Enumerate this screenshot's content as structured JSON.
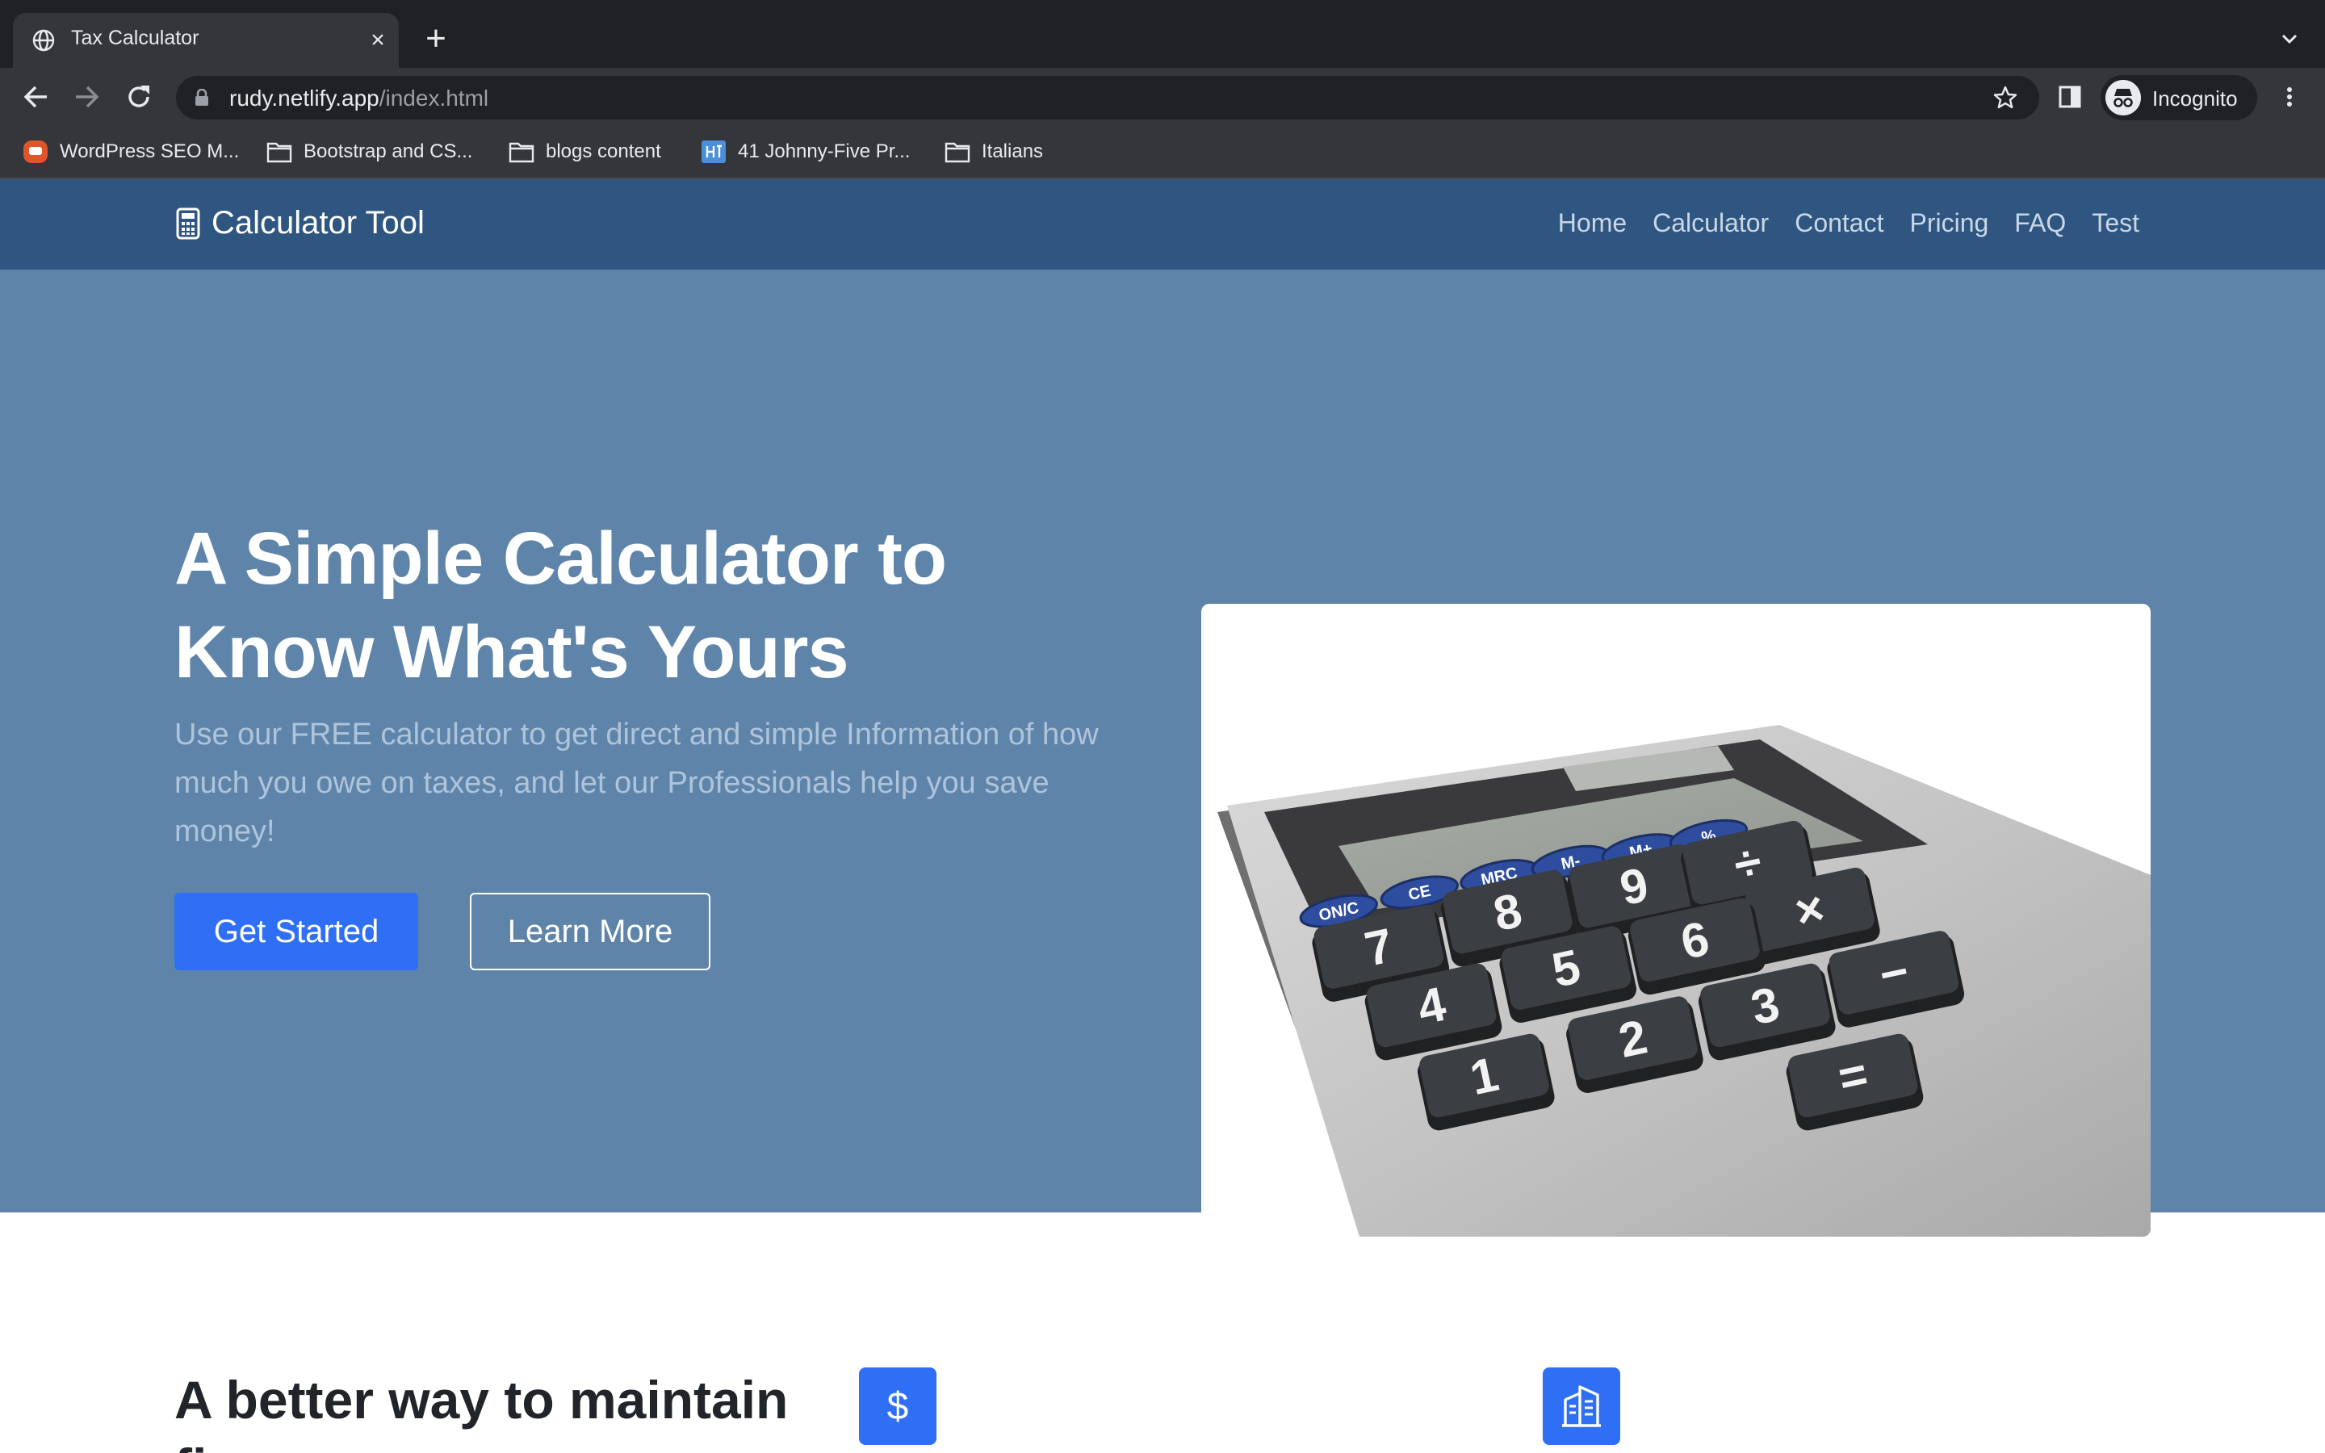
{
  "browser": {
    "tab_title": "Tax Calculator",
    "url_host": "rudy.netlify.app",
    "url_path": "/index.html",
    "profile_label": "Incognito",
    "bookmarks": [
      {
        "label": "WordPress SEO M...",
        "icon": "wordpress-seo-icon"
      },
      {
        "label": "Bootstrap and CS...",
        "icon": "folder-icon"
      },
      {
        "label": "blogs content",
        "icon": "folder-icon"
      },
      {
        "label": "41 Johnny-Five Pr...",
        "icon": "site-favicon-icon"
      },
      {
        "label": "Italians",
        "icon": "folder-icon"
      }
    ]
  },
  "navbar": {
    "brand": "Calculator Tool",
    "brand_icon": "calculator-icon",
    "links": [
      "Home",
      "Calculator",
      "Contact",
      "Pricing",
      "FAQ",
      "Test"
    ]
  },
  "hero": {
    "title": "A Simple Calculator to Know What's Yours",
    "subtitle": "Use our FREE calculator to get direct and simple Information of how much you owe on taxes, and let our Professionals help you save money!",
    "primary_button": "Get Started",
    "secondary_button": "Learn More",
    "image": "calculator-photo",
    "keys": [
      "ON/C",
      "CE",
      "MRC",
      "M-",
      "M+",
      "%",
      "7",
      "8",
      "9",
      "÷",
      "×",
      "4",
      "5",
      "6",
      "−",
      "1",
      "2",
      "3",
      "="
    ]
  },
  "features": {
    "title": "A better way to maintain finances",
    "icons": [
      "dollar-icon",
      "building-icon"
    ],
    "dollar_glyph": "$"
  },
  "colors": {
    "navbar": "#2e5680",
    "hero_bg": "#5f84aa",
    "primary": "#2f6ff5",
    "chrome_dark": "#202124",
    "chrome_tab": "#35363a"
  }
}
